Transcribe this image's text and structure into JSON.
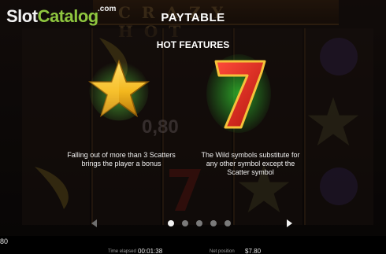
{
  "logo": {
    "slot": "Slot",
    "catalog": "Catalog",
    "com": ".com"
  },
  "background": {
    "game_title": "CRAZY HOT",
    "ghost_value": "0,80"
  },
  "paytable": {
    "title": "PAYTABLE",
    "subtitle": "HOT FEATURES",
    "features": [
      {
        "icon": "gold-star-scatter-icon",
        "description": "Falling out of more than 3 Scatters brings the player a bonus"
      },
      {
        "icon": "red-seven-wild-icon",
        "description": "The Wild symbols substitute for any other symbol except the Scatter symbol"
      }
    ]
  },
  "pager": {
    "pages": 5,
    "current_page": 1
  },
  "bottom_bar": {
    "balance_fragment": "80",
    "time_elapsed_label": "Time elapsed",
    "time_elapsed_value": "00:01:38",
    "net_position_label": "Net position",
    "net_position_value": "$7.80"
  },
  "colors": {
    "logo_green": "#8ec63f",
    "star_gold": "#f3b81e",
    "seven_red": "#d9261c",
    "glow_green": "#3cff3c"
  }
}
